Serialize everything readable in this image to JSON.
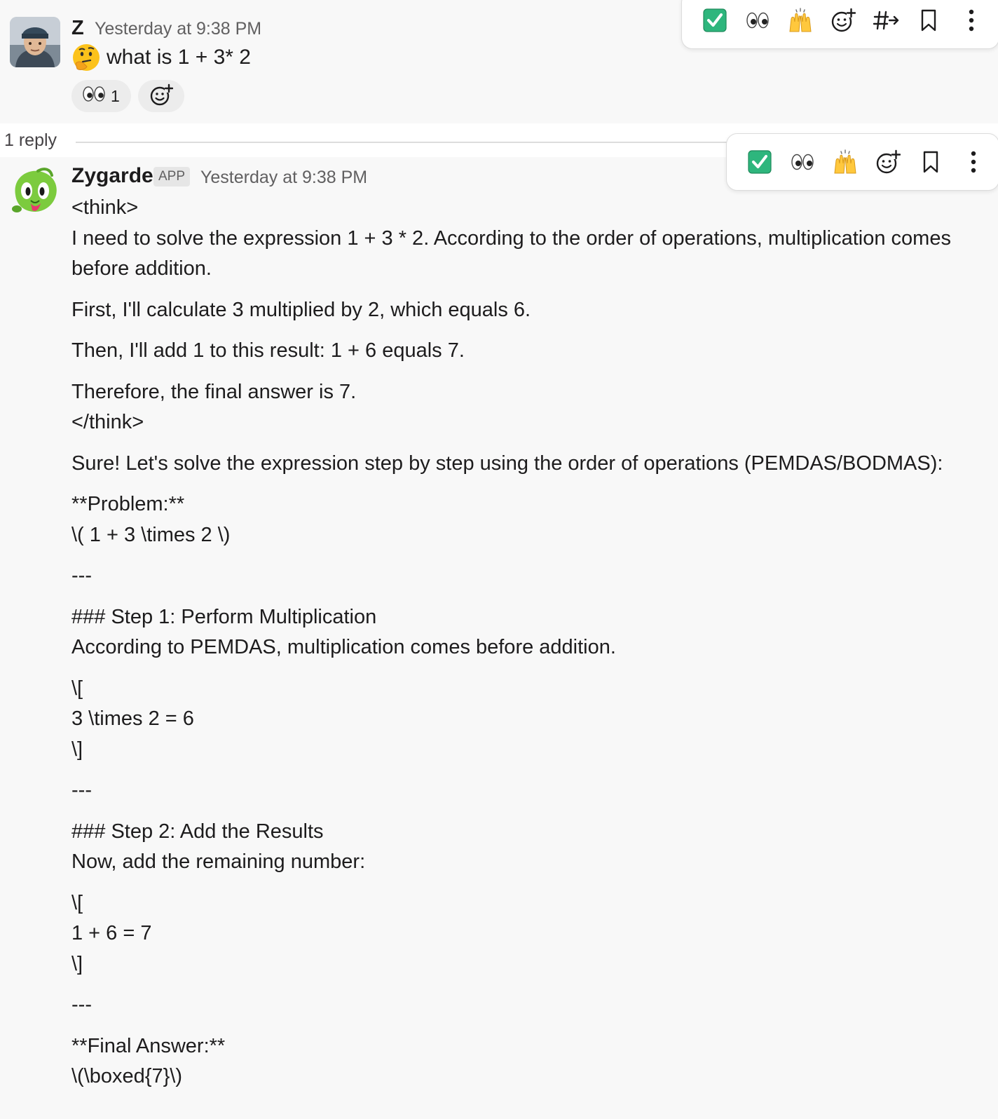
{
  "thread": {
    "message1": {
      "author": "Z",
      "timestamp": "Yesterday at 9:38 PM",
      "text": "what is  1 + 3* 2",
      "reactions": [
        {
          "emoji": "eyes-emoji",
          "count": "1"
        }
      ]
    },
    "reply_divider": {
      "label": "1 reply"
    },
    "message2": {
      "author": "Zygarde",
      "badge": "APP",
      "timestamp": "Yesterday at 9:38 PM",
      "paragraphs": [
        "<think>\nI need to solve the expression 1 + 3 * 2. According to the order of operations, multiplication comes before addition.",
        "First, I'll calculate 3 multiplied by 2, which equals 6.",
        "Then, I'll add 1 to this result: 1 + 6 equals 7.",
        "Therefore, the final answer is 7.\n</think>",
        "Sure! Let's solve the expression step by step using the order of operations (PEMDAS/BODMAS):",
        "**Problem:**\n\\( 1 + 3 \\times 2 \\)",
        "---",
        "### Step 1: Perform Multiplication\nAccording to PEMDAS, multiplication comes before addition.",
        "\\[\n3 \\times 2 = 6\n\\]",
        "---",
        "### Step 2: Add the Results\nNow, add the remaining number:",
        "\\[\n1 + 6 = 7\n\\]",
        "---",
        "**Final Answer:**\n\\(\\boxed{7}\\)"
      ]
    }
  },
  "toolbars": {
    "message1": [
      "check-mark-emoji",
      "eyes-emoji",
      "raised-hands-emoji",
      "add-reaction-icon",
      "forward-to-channel-icon",
      "bookmark-icon",
      "more-actions-icon"
    ],
    "message2": [
      "check-mark-emoji",
      "eyes-emoji",
      "raised-hands-emoji",
      "add-reaction-icon",
      "bookmark-icon",
      "more-actions-icon"
    ]
  },
  "colors": {
    "background": "#f8f8f8",
    "text": "#1d1c1d",
    "muted_text": "#616061",
    "check_green": "#2eb67d"
  }
}
